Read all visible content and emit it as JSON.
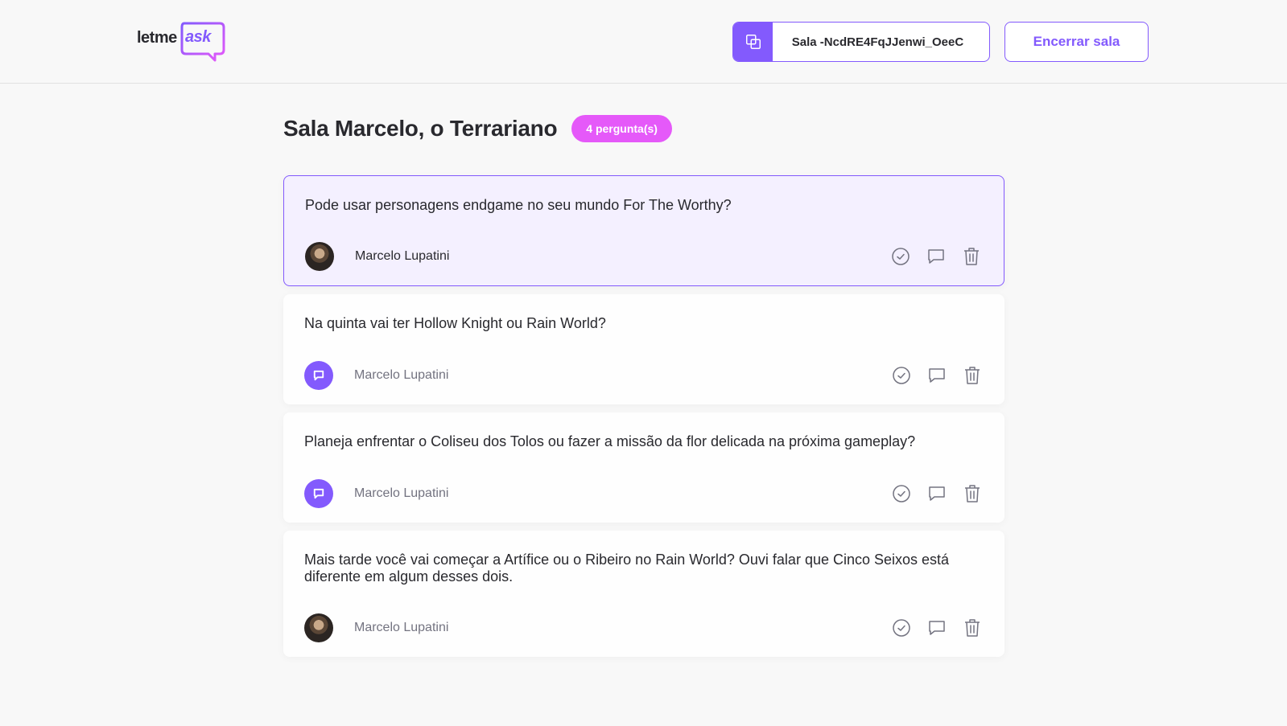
{
  "header": {
    "logo_letme": "letme",
    "logo_ask": "ask",
    "room_code_label": "Sala -NcdRE4FqJJenwi_OeeC",
    "end_room_label": "Encerrar sala"
  },
  "room": {
    "title": "Sala Marcelo, o Terrariano",
    "question_count": "4 pergunta(s)"
  },
  "questions": [
    {
      "content": "Pode usar personagens endgame no seu mundo For The Worthy?",
      "author": "Marcelo Lupatini",
      "avatar": "photo",
      "highlighted": true
    },
    {
      "content": "Na quinta vai ter Hollow Knight ou Rain World?",
      "author": "Marcelo Lupatini",
      "avatar": "default-chat-icon",
      "highlighted": false
    },
    {
      "content": "Planeja enfrentar o Coliseu dos Tolos ou fazer a missão da flor delicada na próxima gameplay?",
      "author": "Marcelo Lupatini",
      "avatar": "default-chat-icon",
      "highlighted": false
    },
    {
      "content": "Mais tarde você vai começar a Artífice ou o Ribeiro no Rain World? Ouvi falar que Cinco Seixos está diferente em algum desses dois.",
      "author": "Marcelo Lupatini",
      "avatar": "photo",
      "highlighted": false
    }
  ],
  "colors": {
    "accent": "#835afd",
    "badge": "#e559f9",
    "highlight_bg": "#f4f0ff",
    "page_bg": "#f8f8f8"
  },
  "icons": {
    "copy": "copy-icon",
    "check": "check-circle-icon",
    "answer": "chat-bubble-icon",
    "delete": "trash-icon"
  }
}
